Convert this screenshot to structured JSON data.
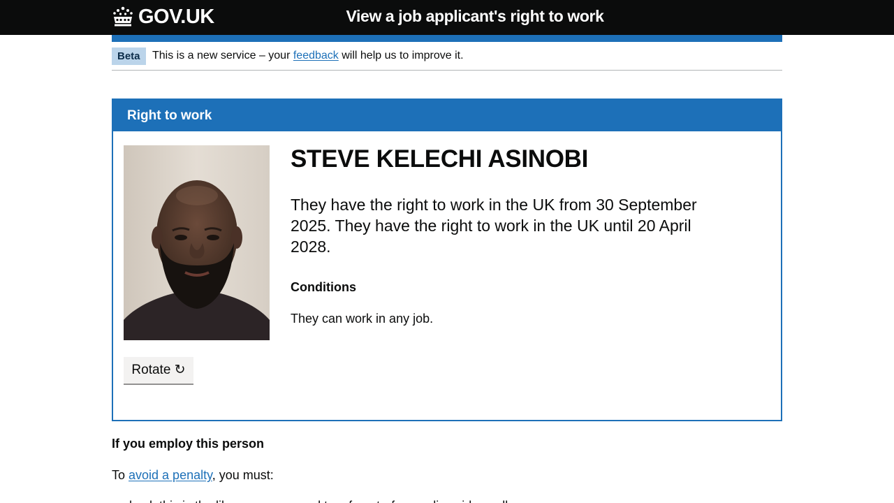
{
  "header": {
    "logo_text": "GOV.UK",
    "service_name": "View a job applicant's right to work"
  },
  "phase_banner": {
    "tag": "Beta",
    "text_before": "This is a new service – your ",
    "link_text": "feedback",
    "text_after": " will help us to improve it."
  },
  "panel": {
    "title": "Right to work",
    "person_name": "STEVE KELECHI ASINOBI",
    "summary": "They have the right to work in the UK from 30 September 2025. They have the right to work in the UK until 20 April 2028.",
    "conditions_heading": "Conditions",
    "conditions_text": "They can work in any job.",
    "rotate_button": "Rotate ↻"
  },
  "employ": {
    "heading": "If you employ this person",
    "penalty_before": "To ",
    "penalty_link": "avoid a penalty",
    "penalty_after": ", you must:",
    "first_item_partial": "check this is the likeness compared to a face-to-face or live video call"
  },
  "colors": {
    "header_bg": "#0b0c0c",
    "brand_blue": "#1d70b8",
    "tag_bg": "#bbd4ea",
    "button_bg": "#f3f2f1"
  },
  "icons": {
    "logo": "crown-icon",
    "rotate": "rotate-icon"
  }
}
